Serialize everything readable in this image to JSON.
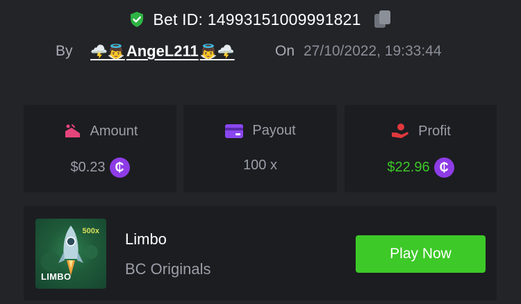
{
  "bet": {
    "id_label": "Bet ID: 14993151009991821",
    "by_label": "By",
    "user": {
      "emoji_left": "🌩️👼",
      "name": "AngeL211",
      "emoji_right": "👼🌩️"
    },
    "on_label": "On",
    "datetime": "27/10/2022, 19:33:44"
  },
  "stats": {
    "amount": {
      "label": "Amount",
      "value": "$0.23",
      "coin": "₵"
    },
    "payout": {
      "label": "Payout",
      "value": "100 x"
    },
    "profit": {
      "label": "Profit",
      "value": "$22.96",
      "coin": "₵"
    }
  },
  "game": {
    "name": "Limbo",
    "provider": "BC Originals",
    "thumb_label": "LIMBO",
    "thumb_multiplier": "500x",
    "play_label": "Play Now"
  },
  "colors": {
    "background": "#232428",
    "card": "#1c1d21",
    "accent_green": "#3dc928",
    "coin_purple": "#8e3ce6",
    "amount_icon": "#e5457a",
    "payout_icon": "#8a47f0",
    "profit_icon": "#e0383e",
    "shield": "#2fb344"
  },
  "icons": {
    "shield": "shield-check-icon",
    "copy": "copy-icon",
    "amount": "amount-icon",
    "payout": "card-icon",
    "profit": "hand-coin-icon"
  }
}
